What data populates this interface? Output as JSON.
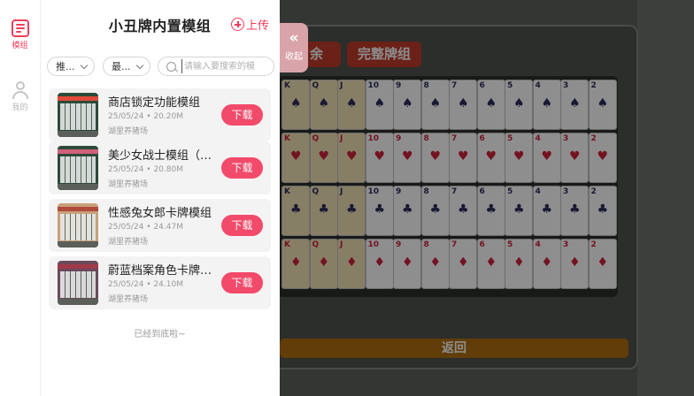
{
  "panel": {
    "title": "小丑牌内置模组",
    "upload_label": "上传",
    "collapse_label": "收起",
    "collapse_icon": "double-chevron-left-icon"
  },
  "side_nav": [
    {
      "label": "模组",
      "icon": "list-icon",
      "active": true
    },
    {
      "label": "我的",
      "icon": "person-icon",
      "active": false
    }
  ],
  "filters": {
    "sort_label": "推...",
    "time_label": "最...",
    "search_placeholder": "请输入要搜索的模"
  },
  "items": [
    {
      "name": "商店锁定功能模组",
      "date": "25/05/24",
      "size": "20.20M",
      "author": "湖里养猪场",
      "button": "下载"
    },
    {
      "name": "美少女战士模组（替...",
      "date": "25/05/24",
      "size": "20.80M",
      "author": "湖里养猪场",
      "button": "下载"
    },
    {
      "name": "性感兔女郎卡牌模组",
      "date": "25/05/24",
      "size": "24.47M",
      "author": "湖里养猪场",
      "button": "下载"
    },
    {
      "name": "蔚蓝档案角色卡牌模...",
      "date": "25/05/24",
      "size": "24.10M",
      "author": "湖里养猪场",
      "button": "下载"
    }
  ],
  "end_text": "已经到底啦~",
  "game": {
    "btn_remain": "余",
    "btn_full": "完整牌组",
    "back_label": "返回",
    "rows": [
      {
        "suit": "♠",
        "color": "black",
        "ranks": [
          "K",
          "Q",
          "J",
          "10",
          "9",
          "8",
          "7",
          "6",
          "5",
          "4",
          "3",
          "2"
        ]
      },
      {
        "suit": "♥",
        "color": "red",
        "ranks": [
          "K",
          "Q",
          "J",
          "10",
          "9",
          "8",
          "7",
          "6",
          "5",
          "4",
          "3",
          "2"
        ]
      },
      {
        "suit": "♣",
        "color": "black",
        "ranks": [
          "K",
          "Q",
          "J",
          "10",
          "9",
          "8",
          "7",
          "6",
          "5",
          "4",
          "3",
          "2"
        ]
      },
      {
        "suit": "♦",
        "color": "red",
        "ranks": [
          "K",
          "Q",
          "J",
          "10",
          "9",
          "8",
          "7",
          "6",
          "5",
          "4",
          "3",
          "2"
        ]
      }
    ]
  },
  "colors": {
    "accent": "#f24a6a",
    "back_bar": "#a8690e",
    "top_btn": "#b83a2a"
  }
}
